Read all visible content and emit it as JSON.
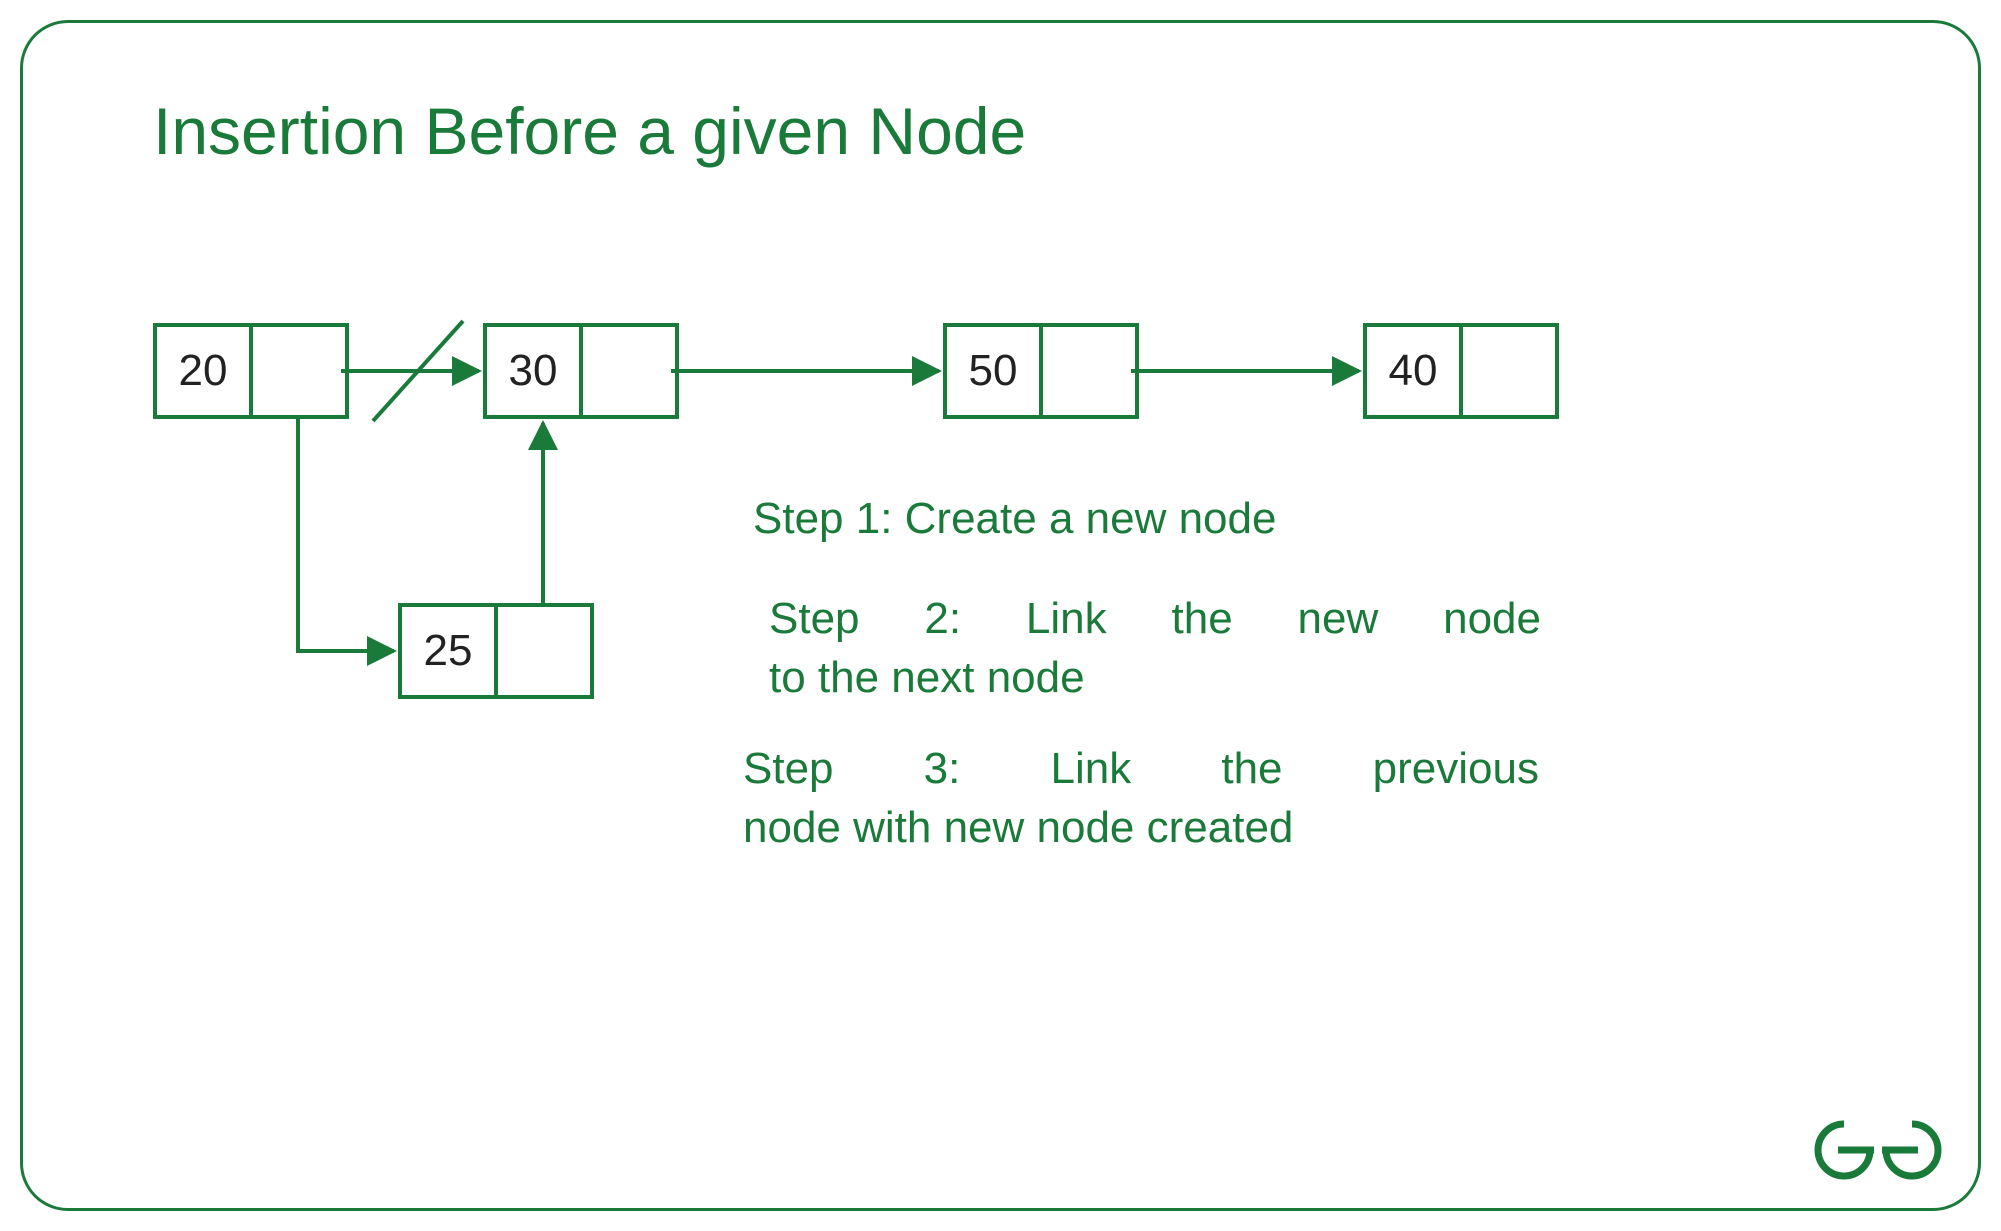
{
  "title": "Insertion Before a given Node",
  "nodes": {
    "n1": "20",
    "n2": "30",
    "n3": "50",
    "n4": "40",
    "new": "25"
  },
  "steps": {
    "s1": "Step 1: Create a new node",
    "s2a": "Step 2: Link the new node",
    "s2b": "to the next node",
    "s3a": "Step 3: Link the previous",
    "s3b": "node with new node created"
  },
  "colors": {
    "accent": "#1a7a3a"
  }
}
